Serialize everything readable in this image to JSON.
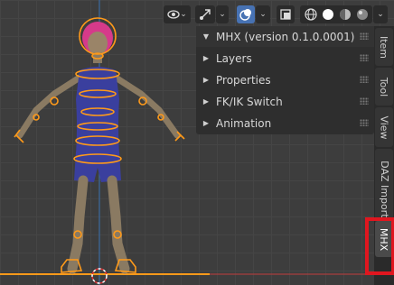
{
  "viewport": {
    "name": "3D Viewport",
    "colors": {
      "background": "#3d3d3d",
      "rig": "#ff9a1a",
      "mesh_tint": "#3a3f9e",
      "skin": "#8a7a62",
      "hair": "#d63a8a",
      "axis_red": "#a83e3e",
      "axis_blue": "#3b6aa0"
    }
  },
  "toolbar": {
    "icons": [
      "eye-visibility-icon",
      "gizmo-icon",
      "overlay-icon",
      "xray-icon",
      "wireframe-shading-icon",
      "solid-shading-icon",
      "material-shading-icon",
      "rendered-shading-icon"
    ]
  },
  "panel": {
    "rows": [
      {
        "label": "MHX (version 0.1.0.0001)",
        "expanded": true
      },
      {
        "label": "Layers",
        "expanded": false
      },
      {
        "label": "Properties",
        "expanded": false
      },
      {
        "label": "FK/IK Switch",
        "expanded": false
      },
      {
        "label": "Animation",
        "expanded": false
      }
    ]
  },
  "tabs": [
    "Item",
    "Tool",
    "View",
    "DAZ Importer",
    "MHX"
  ],
  "active_tab": "MHX"
}
